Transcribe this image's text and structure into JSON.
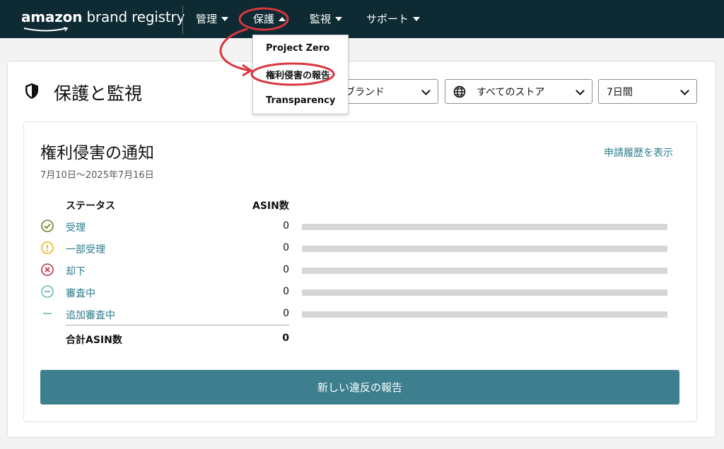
{
  "header": {
    "logo_brand": "amazon",
    "logo_rest": "brand registry",
    "nav": [
      {
        "label": "管理",
        "caret": "down"
      },
      {
        "label": "保護",
        "caret": "up"
      },
      {
        "label": "監視",
        "caret": "down"
      },
      {
        "label": "サポート",
        "caret": "down"
      }
    ]
  },
  "dropdown": {
    "items": [
      "Project Zero",
      "権利侵害の報告",
      "Transparency"
    ]
  },
  "page": {
    "title": "保護と監視",
    "filters": {
      "brand": "ブランド",
      "store": "すべてのストア",
      "period": "7日間"
    }
  },
  "notice": {
    "title": "権利侵害の通知",
    "date_range": "7月10日〜2025年7月16日",
    "history_link": "申請履歴を表示",
    "col_status": "ステータス",
    "col_asin": "ASIN数",
    "rows": [
      {
        "label": "受理",
        "count": "0",
        "icon": "check-circle-icon"
      },
      {
        "label": "一部受理",
        "count": "0",
        "icon": "exclamation-circle-icon"
      },
      {
        "label": "却下",
        "count": "0",
        "icon": "x-circle-icon"
      },
      {
        "label": "審査中",
        "count": "0",
        "icon": "minus-circle-icon"
      },
      {
        "label": "追加審査中",
        "count": "0",
        "icon": "dash-icon"
      }
    ],
    "total_label": "合計ASIN数",
    "total_value": "0",
    "button_label": "新しい違反の報告"
  },
  "colors": {
    "header_bg": "#0e2a33",
    "accent_teal": "#3d7f8f",
    "link_teal": "#2a7a8c",
    "annotation_red": "#d9363e",
    "check_green": "#6b7f2a",
    "warning_amber": "#e8b21d",
    "error_red": "#c4304a",
    "pending_teal": "#6fb3b8"
  }
}
